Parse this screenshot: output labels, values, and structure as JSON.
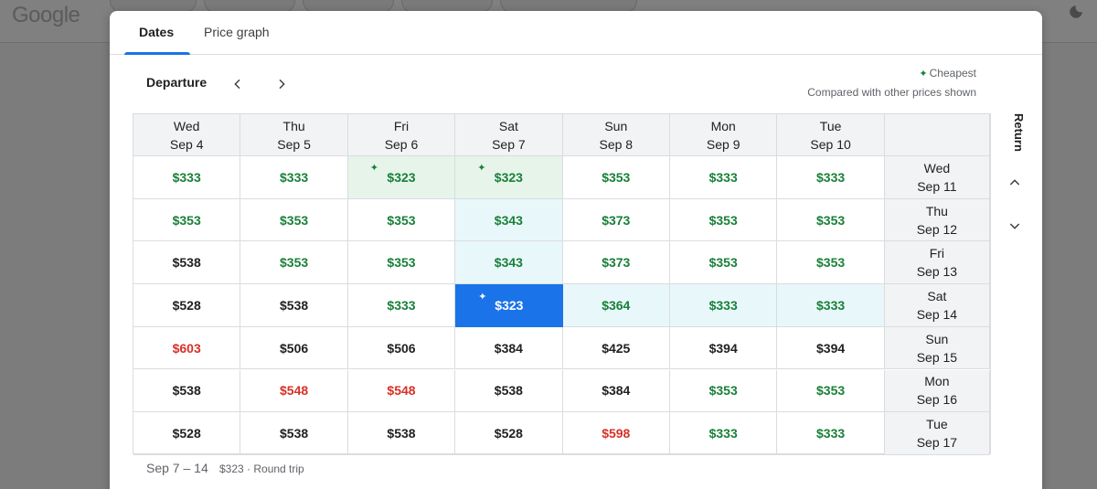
{
  "background": {
    "logo": "Google"
  },
  "tabs": [
    {
      "label": "Dates"
    },
    {
      "label": "Price graph"
    }
  ],
  "departure_label": "Departure",
  "legend": {
    "cheapest": "Cheapest",
    "note": "Compared with other prices shown"
  },
  "return_label": "Return",
  "columns": [
    {
      "day": "Wed",
      "date": "Sep 4"
    },
    {
      "day": "Thu",
      "date": "Sep 5"
    },
    {
      "day": "Fri",
      "date": "Sep 6"
    },
    {
      "day": "Sat",
      "date": "Sep 7"
    },
    {
      "day": "Sun",
      "date": "Sep 8"
    },
    {
      "day": "Mon",
      "date": "Sep 9"
    },
    {
      "day": "Tue",
      "date": "Sep 10"
    }
  ],
  "rows": [
    {
      "day": "Wed",
      "date": "Sep 11",
      "prices": [
        {
          "v": "$333",
          "c": "green"
        },
        {
          "v": "$333",
          "c": "green"
        },
        {
          "v": "$323",
          "c": "green",
          "cheapest": true
        },
        {
          "v": "$323",
          "c": "green",
          "cheapest": true
        },
        {
          "v": "$353",
          "c": "green"
        },
        {
          "v": "$333",
          "c": "green"
        },
        {
          "v": "$333",
          "c": "green"
        }
      ]
    },
    {
      "day": "Thu",
      "date": "Sep 12",
      "prices": [
        {
          "v": "$353",
          "c": "green"
        },
        {
          "v": "$353",
          "c": "green"
        },
        {
          "v": "$353",
          "c": "green"
        },
        {
          "v": "$343",
          "c": "green"
        },
        {
          "v": "$373",
          "c": "green"
        },
        {
          "v": "$353",
          "c": "green"
        },
        {
          "v": "$353",
          "c": "green"
        }
      ]
    },
    {
      "day": "Fri",
      "date": "Sep 13",
      "prices": [
        {
          "v": "$538",
          "c": "black"
        },
        {
          "v": "$353",
          "c": "green"
        },
        {
          "v": "$353",
          "c": "green"
        },
        {
          "v": "$343",
          "c": "green"
        },
        {
          "v": "$373",
          "c": "green"
        },
        {
          "v": "$353",
          "c": "green"
        },
        {
          "v": "$353",
          "c": "green"
        }
      ]
    },
    {
      "day": "Sat",
      "date": "Sep 14",
      "prices": [
        {
          "v": "$528",
          "c": "black"
        },
        {
          "v": "$538",
          "c": "black"
        },
        {
          "v": "$333",
          "c": "green"
        },
        {
          "v": "$323",
          "c": "white",
          "cheapest": true,
          "selected": true
        },
        {
          "v": "$364",
          "c": "green"
        },
        {
          "v": "$333",
          "c": "green"
        },
        {
          "v": "$333",
          "c": "green"
        }
      ]
    },
    {
      "day": "Sun",
      "date": "Sep 15",
      "prices": [
        {
          "v": "$603",
          "c": "red"
        },
        {
          "v": "$506",
          "c": "black"
        },
        {
          "v": "$506",
          "c": "black"
        },
        {
          "v": "$384",
          "c": "black"
        },
        {
          "v": "$425",
          "c": "black"
        },
        {
          "v": "$394",
          "c": "black"
        },
        {
          "v": "$394",
          "c": "black"
        }
      ]
    },
    {
      "day": "Mon",
      "date": "Sep 16",
      "prices": [
        {
          "v": "$538",
          "c": "black"
        },
        {
          "v": "$548",
          "c": "red"
        },
        {
          "v": "$548",
          "c": "red"
        },
        {
          "v": "$538",
          "c": "black"
        },
        {
          "v": "$384",
          "c": "black"
        },
        {
          "v": "$353",
          "c": "green"
        },
        {
          "v": "$353",
          "c": "green"
        }
      ]
    },
    {
      "day": "Tue",
      "date": "Sep 17",
      "prices": [
        {
          "v": "$528",
          "c": "black"
        },
        {
          "v": "$538",
          "c": "black"
        },
        {
          "v": "$538",
          "c": "black"
        },
        {
          "v": "$528",
          "c": "black"
        },
        {
          "v": "$598",
          "c": "red"
        },
        {
          "v": "$333",
          "c": "green"
        },
        {
          "v": "$333",
          "c": "green"
        }
      ]
    }
  ],
  "footer": {
    "dates": "Sep 7 – 14",
    "price": "$323 · Round trip"
  },
  "colors": {
    "accent": "#1a73e8",
    "green": "#188038",
    "red": "#d93025",
    "column_highlight": "#e8f7fa",
    "cheapest_highlight": "#e6f4ea"
  },
  "selection": {
    "column_index": 3,
    "row_index": 3
  }
}
